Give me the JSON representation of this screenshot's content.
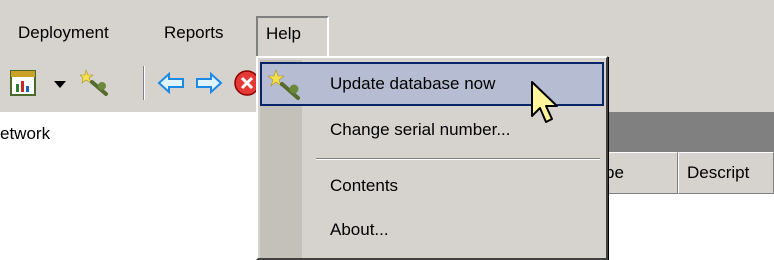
{
  "menubar": {
    "items": [
      {
        "label": "Deployment"
      },
      {
        "label": "Reports"
      },
      {
        "label": "Help"
      }
    ]
  },
  "toolbar": {
    "icons": [
      "report-icon",
      "dropdown-arrow-icon",
      "update-wand-icon",
      "back-arrow-icon",
      "forward-arrow-icon",
      "stop-icon"
    ]
  },
  "tree": {
    "partial_item": "etwork"
  },
  "list_columns": [
    {
      "label": "pe"
    },
    {
      "label": "Descript"
    }
  ],
  "help_menu": {
    "items": [
      {
        "label": "Update database now",
        "icon": "update-wand-icon",
        "highlighted": true
      },
      {
        "label": "Change serial number..."
      },
      {
        "label": "Contents"
      },
      {
        "label": "About..."
      }
    ]
  },
  "colors": {
    "face": "#d6d3ce",
    "highlight": "#b6bdd2",
    "highlight_border": "#0a246a",
    "window": "#ffffff"
  }
}
